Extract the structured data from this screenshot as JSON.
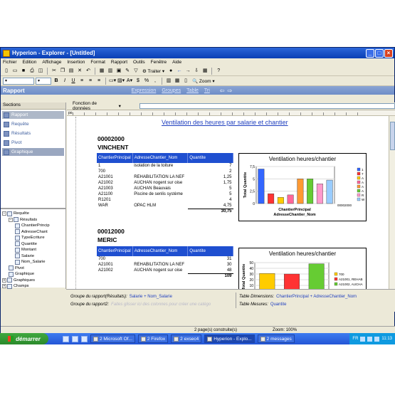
{
  "window": {
    "title": "Hyperion - Explorer - [Untitled]"
  },
  "menu": [
    "Fichier",
    "Edition",
    "Affichage",
    "Insertion",
    "Format",
    "Rapport",
    "Outils",
    "Fenêtre",
    "Aide"
  ],
  "toolbar": {
    "traiter_label": "Traiter",
    "zoom_label": "Zoom"
  },
  "section_bar": {
    "title": "Rapport",
    "links": [
      "Expression",
      "Groupes",
      "Table",
      "Tri"
    ]
  },
  "sections_panel": {
    "header": "Sections",
    "items": [
      "Rapport",
      "Requête",
      "Résultats",
      "Pivot",
      "Graphique"
    ]
  },
  "tree": {
    "items": [
      {
        "label": "Requête",
        "level": 0,
        "exp": "−"
      },
      {
        "label": "Résultats",
        "level": 1,
        "exp": "−"
      },
      {
        "label": "ChantierPrincip",
        "level": 2
      },
      {
        "label": "AdresseChant",
        "level": 2
      },
      {
        "label": "TypeEcriture",
        "level": 2
      },
      {
        "label": "Quantite",
        "level": 2
      },
      {
        "label": "Montant",
        "level": 2
      },
      {
        "label": "Salarie",
        "level": 2
      },
      {
        "label": "Nom_Salarie",
        "level": 2
      },
      {
        "label": "Pivot",
        "level": 1
      },
      {
        "label": "Graphique",
        "level": 1
      },
      {
        "label": "Graphiques",
        "level": 0,
        "exp": "+"
      },
      {
        "label": "Champs",
        "level": 0,
        "exp": "+"
      }
    ]
  },
  "fn_bar": {
    "label": "Fonction de données"
  },
  "report": {
    "title": "Ventilation des heures par salarie et chantier",
    "groups": [
      {
        "id": "00002000",
        "name": "VINCHENT",
        "headers": [
          "ChantierPrincipal",
          "AdresseChantier_Nom",
          "Quantite"
        ],
        "rows": [
          [
            "1",
            "isolation de la toiture",
            "7"
          ],
          [
            "700",
            "",
            "2"
          ],
          [
            "A21001",
            "REHABILITATION LA NEF",
            "1,25"
          ],
          [
            "A21002",
            "AUCHAN nogent sur oise",
            "1,75"
          ],
          [
            "A21003",
            "AUCHAN Beauvais",
            "5"
          ],
          [
            "A21100",
            "Piscine de senlis système",
            "5"
          ],
          [
            "R1201",
            "",
            "4"
          ],
          [
            "WAR",
            "OPAC HLM",
            "4,75"
          ]
        ],
        "total": "30,75"
      },
      {
        "id": "00012000",
        "name": "MERIC",
        "headers": [
          "ChantierPrincipal",
          "AdresseChantier_Nom",
          "Quantite"
        ],
        "rows": [
          [
            "700",
            "",
            "31"
          ],
          [
            "A21001",
            "REHABILITATION LA NEF",
            "30"
          ],
          [
            "A21002",
            "AUCHAN nogent sur oise",
            "48"
          ]
        ],
        "total": "109"
      }
    ]
  },
  "chart_data": [
    {
      "type": "bar",
      "title": "Ventilation heures/chantier",
      "ylabel": "Total Quantite",
      "xlabel": "ChantierPrincipal\nAdresseChantier_Nom",
      "x_note": "00002000",
      "ylim": [
        0,
        7.5
      ],
      "yticks": [
        "0",
        "2,5",
        "5",
        "7,5"
      ],
      "values": [
        7,
        2,
        1.25,
        1.75,
        5,
        5,
        4,
        4.75
      ],
      "colors": [
        "#3366ff",
        "#ff3333",
        "#ffcc00",
        "#ff6699",
        "#ff9933",
        "#66cc33",
        "#ff99cc",
        "#99ccff"
      ],
      "legend_marks": [
        "1",
        "7",
        "A",
        "A",
        "A",
        "A",
        "R",
        "W"
      ]
    },
    {
      "type": "bar",
      "title": "Ventilation heures/chantier",
      "ylabel": "Total Quantite",
      "ylim": [
        0,
        50
      ],
      "yticks": [
        "0",
        "10",
        "20",
        "30",
        "40",
        "50"
      ],
      "values": [
        31,
        30,
        48
      ],
      "colors": [
        "#ffcc00",
        "#ff3333",
        "#66cc33"
      ],
      "legend": [
        "700",
        "A21001, REHAB",
        "A21002, AUCHA"
      ]
    }
  ],
  "bottom_panels": {
    "group_label_1": "Groupe du rapport(Résultats):",
    "group_value_1": "Salarie + Nom_Salarie",
    "group_label_2": "Groupe du rapport2:",
    "group_hint_2": "Faites glisser ici des colonnes pour créer une catégo",
    "table_dim_label": "Table Dimensions:",
    "table_dim_value": "ChantierPrincipal + AdresseChantier_Nom",
    "table_measures_label": "Table Mesures:",
    "table_measures_value": "Quantite"
  },
  "status": {
    "pages": "2 page(s) construite(s)",
    "zoom": "Zoom: 100%"
  },
  "taskbar": {
    "start": "démarrer",
    "tasks": [
      "2 Microsoft Of...",
      "2 Firefox",
      "2 exsec4",
      "Hyperion - Explo...",
      "2 messages"
    ],
    "tray_lang": "FR",
    "clock": "11:13"
  }
}
